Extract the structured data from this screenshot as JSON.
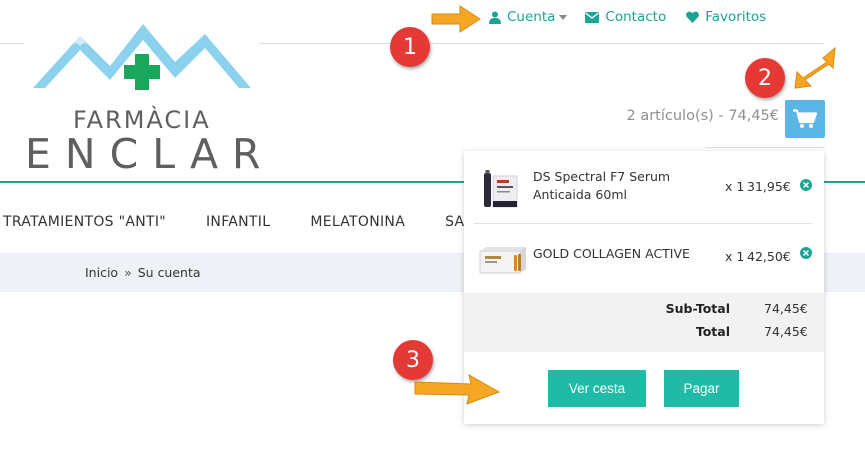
{
  "top_links": {
    "cuenta": "Cuenta",
    "contacto": "Contacto",
    "favoritos": "Favoritos"
  },
  "logo": {
    "line1": "FARMÀCIA",
    "line2": "ENCLAR"
  },
  "cart": {
    "summary": "2 artículo(s) - 74,45€"
  },
  "nav": {
    "items": [
      "TRATAMIENTOS \"ANTI\"",
      "INFANTIL",
      "MELATONINA",
      "SAL"
    ]
  },
  "breadcrumb": {
    "home": "Inicio",
    "separator": "»",
    "current": "Su cuenta"
  },
  "dropdown": {
    "items": [
      {
        "name_line1": "DS Spectral F7 Serum",
        "name_line2": "Anticaida 60ml",
        "qty": "x 1",
        "price": "31,95€"
      },
      {
        "name_line1": "GOLD COLLAGEN ACTIVE",
        "name_line2": "",
        "qty": "x 1",
        "price": "42,50€"
      }
    ],
    "subtotal_label": "Sub-Total",
    "subtotal_value": "74,45€",
    "total_label": "Total",
    "total_value": "74,45€",
    "view_cart_label": "Ver cesta",
    "checkout_label": "Pagar"
  },
  "annotations": {
    "badge1": "1",
    "badge2": "2",
    "badge3": "3"
  },
  "colors": {
    "accent": "#1ba394",
    "button": "#1fbba6",
    "cart_button": "#5bb6e6",
    "badge": "#e53935",
    "arrow": "#f5a623"
  }
}
